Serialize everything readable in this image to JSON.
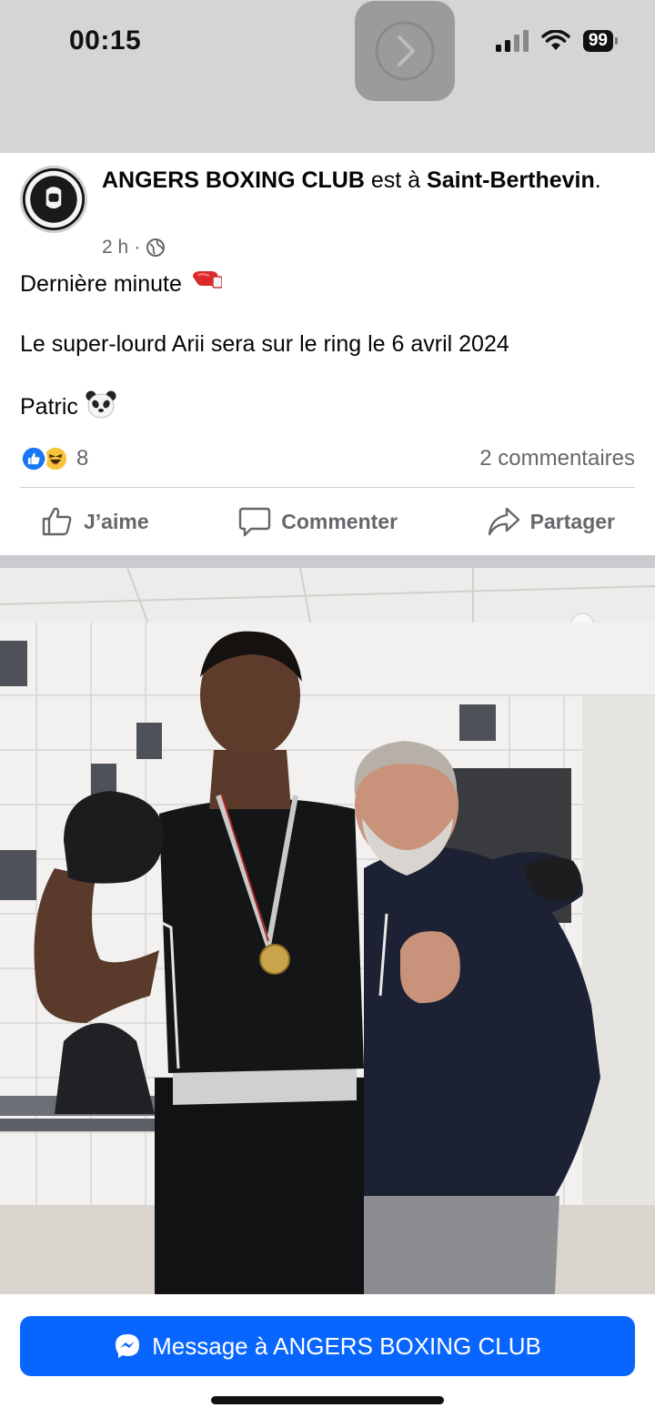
{
  "status_bar": {
    "time": "00:15",
    "battery": "99",
    "center_icon": "chevron-right-icon"
  },
  "post": {
    "page_name": "ANGERS BOXING CLUB",
    "connector": "est à",
    "location": "Saint-Berthevin",
    "location_suffix": ".",
    "age": "2 h",
    "separator": "·",
    "privacy_icon": "globe-icon",
    "text_line1": "Dernière minute",
    "text_line2": "Le super-lourd Arii sera sur le ring le 6 avril 2024",
    "text_line3": "Patric",
    "emoji_line1": "boxing-glove-emoji",
    "emoji_line3": "panda-emoji"
  },
  "reactions": {
    "count": "8",
    "icons": [
      "like-reaction-icon",
      "haha-reaction-icon"
    ],
    "comments_label": "2 commentaires"
  },
  "actions": {
    "like_label": "J’aime",
    "comment_label": "Commenter",
    "share_label": "Partager"
  },
  "message_button": {
    "label": "Message à ANGERS BOXING CLUB",
    "icon": "messenger-icon"
  },
  "colors": {
    "accent": "#0866ff",
    "secondary_text": "#65676b",
    "status_bar_bg": "#d5d5d7"
  }
}
